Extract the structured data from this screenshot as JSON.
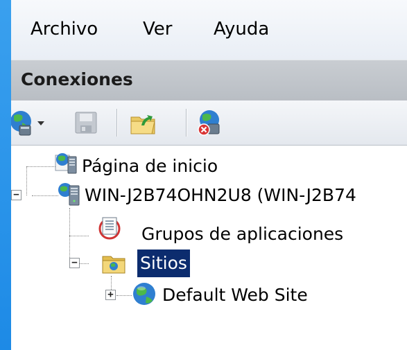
{
  "menu": {
    "items": [
      {
        "label": "Archivo"
      },
      {
        "label": "Ver"
      },
      {
        "label": "Ayuda"
      }
    ]
  },
  "panel": {
    "title": "Conexiones"
  },
  "toolbar": {
    "buttons": [
      {
        "icon": "globe-connect-icon"
      },
      {
        "icon": "save-icon"
      },
      {
        "icon": "open-folder-icon"
      },
      {
        "icon": "disconnect-icon"
      }
    ]
  },
  "tree": {
    "items": [
      {
        "label": "Página de inicio"
      },
      {
        "label": "WIN-J2B74OHN2U8 (WIN-J2B74"
      },
      {
        "label": "Grupos de aplicaciones"
      },
      {
        "label": "Sitios"
      },
      {
        "label": "Default Web Site"
      }
    ],
    "selected_index": 3
  },
  "colors": {
    "selection": "#0c2c6e",
    "header": "#c4c8cd",
    "frame": "#2a90e0"
  }
}
